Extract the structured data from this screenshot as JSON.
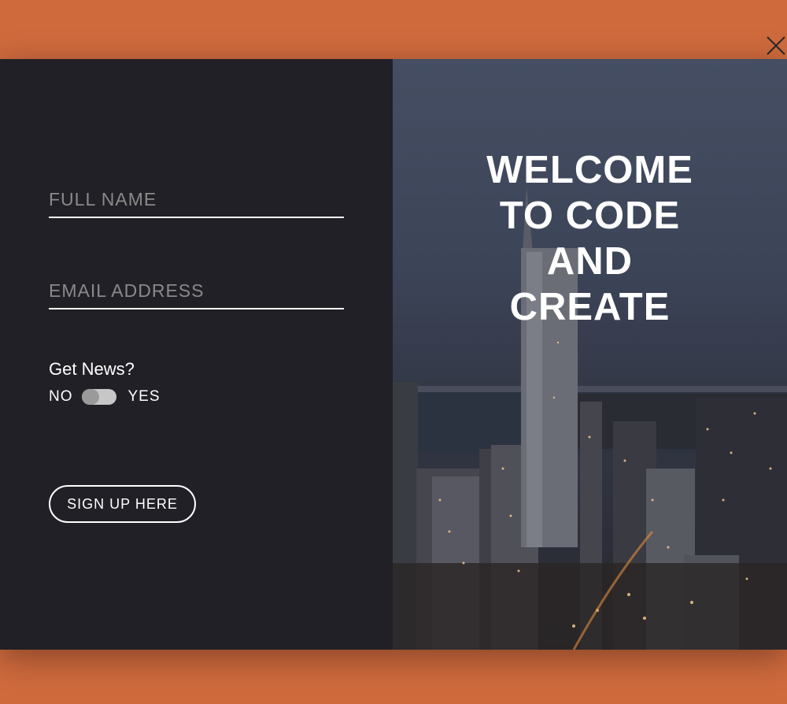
{
  "form": {
    "full_name_placeholder": "FULL NAME",
    "email_placeholder": "EMAIL ADDRESS",
    "news_label": "Get News?",
    "toggle_no": "NO",
    "toggle_yes": "YES",
    "toggle_state": "off",
    "signup_label": "SIGN UP HERE"
  },
  "hero": {
    "lines": [
      "WELCOME",
      "TO CODE",
      "AND",
      "CREATE"
    ],
    "image": "city-skyline-night"
  },
  "icons": {
    "close": "close-icon"
  },
  "colors": {
    "background": "#cf6a3d",
    "form_panel": "#212026",
    "accent_text": "#ffffff",
    "placeholder": "#8a8a8a"
  }
}
